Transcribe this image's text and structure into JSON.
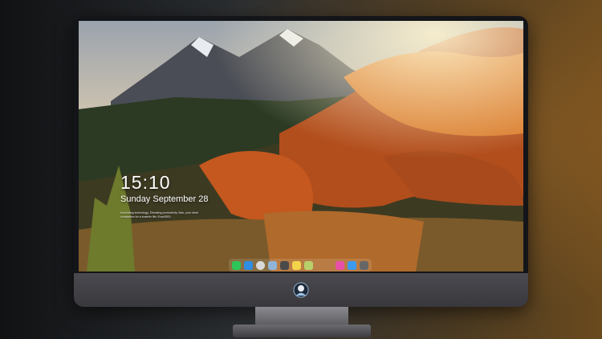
{
  "lock_screen": {
    "time": "15:10",
    "date": "Sunday September 28",
    "tagline": "Innovating technology, Elevating productivity. Mac, your ideal companion for a smarter life. Exce3500"
  },
  "dock": {
    "apps_left": [
      {
        "icon": "messages-icon",
        "color": "#2ec45a"
      },
      {
        "icon": "finder-icon",
        "color": "#2f8de4"
      },
      {
        "icon": "safari-icon",
        "color": "#d9d9d9"
      },
      {
        "icon": "preview-icon",
        "color": "#8fb4d8"
      },
      {
        "icon": "imovie-icon",
        "color": "#4a4a4a"
      },
      {
        "icon": "notes-icon",
        "color": "#f4d44a"
      },
      {
        "icon": "photos-icon",
        "color": "#b8d06a"
      }
    ],
    "apps_right": [
      {
        "icon": "itunes-icon",
        "color": "#e84fa6"
      },
      {
        "icon": "app-store-icon",
        "color": "#3a9bf0"
      },
      {
        "icon": "camera-icon",
        "color": "#666666"
      }
    ]
  },
  "colors": {
    "sky": "#b8bfc6",
    "foliage": "#c4581e",
    "forest": "#2c3a24"
  }
}
